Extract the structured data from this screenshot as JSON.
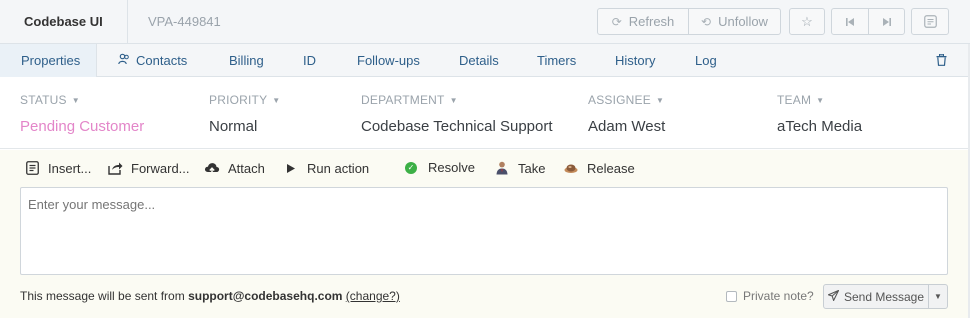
{
  "header": {
    "app_title": "Codebase UI",
    "ticket_ref": "VPA-449841",
    "refresh_label": "Refresh",
    "unfollow_label": "Unfollow"
  },
  "tabs": [
    {
      "label": "Properties",
      "active": true
    },
    {
      "label": "Contacts"
    },
    {
      "label": "Billing"
    },
    {
      "label": "ID"
    },
    {
      "label": "Follow-ups"
    },
    {
      "label": "Details"
    },
    {
      "label": "Timers"
    },
    {
      "label": "History"
    },
    {
      "label": "Log"
    }
  ],
  "properties": [
    {
      "label": "STATUS",
      "value": "Pending Customer",
      "color": "#e386c9"
    },
    {
      "label": "PRIORITY",
      "value": "Normal"
    },
    {
      "label": "DEPARTMENT",
      "value": "Codebase Technical Support"
    },
    {
      "label": "ASSIGNEE",
      "value": "Adam West"
    },
    {
      "label": "TEAM",
      "value": "aTech Media"
    }
  ],
  "toolbar": {
    "insert": "Insert...",
    "forward": "Forward...",
    "attach": "Attach",
    "run_action": "Run action",
    "resolve": "Resolve",
    "take": "Take",
    "release": "Release"
  },
  "composer": {
    "placeholder": "Enter your message...",
    "value": "",
    "sent_from_prefix": "This message will be sent from ",
    "sent_from_email": "support@codebasehq.com",
    "change_link": "(change?)",
    "private_note_label": "Private note?",
    "private_note_checked": false,
    "send_label": "Send Message"
  },
  "icons": {
    "refresh": "refresh-icon",
    "unfollow": "unfollow-icon",
    "star": "star-icon",
    "prev": "previous-icon",
    "next": "next-icon",
    "sidebar": "sidebar-toggle-icon",
    "contacts": "contacts-icon",
    "trash": "trash-icon",
    "resolve": "check-circle-icon",
    "take": "person-icon",
    "release": "release-icon",
    "send": "paper-plane-icon"
  },
  "colors": {
    "status_pending": "#e386c9",
    "link": "#2e5f8a",
    "resolve_green": "#3cb046",
    "composer_bg": "#fbfbf3"
  }
}
